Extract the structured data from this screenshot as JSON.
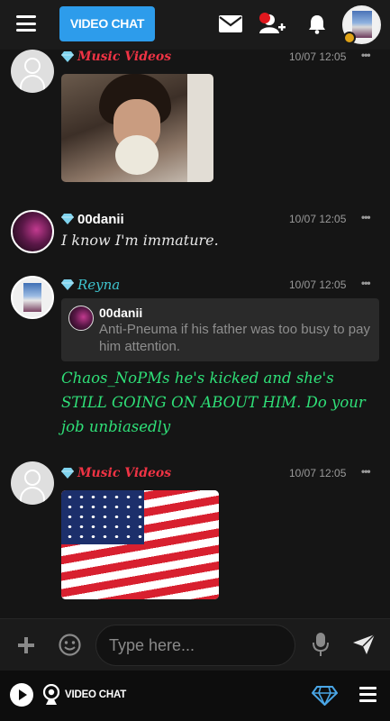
{
  "header": {
    "video_chat_label": "VIDEO CHAT",
    "accent_color": "#2d9ceb"
  },
  "messages": [
    {
      "username": "Music Videos",
      "time": "10/07 12:05",
      "media": "gif"
    },
    {
      "username": "00danii",
      "time": "10/07 12:05",
      "text": "I know I'm immature."
    },
    {
      "username": "Reyna",
      "time": "10/07 12:05",
      "quote": {
        "username": "00danii",
        "text": "Anti-Pneuma if his father was too busy to pay him attention."
      },
      "text": "Chaos_NoPMs he's kicked and she's STILL GOING ON ABOUT HIM. Do your job unbiasedly",
      "text_color": "#2fe078"
    },
    {
      "username": "Music Videos",
      "time": "10/07 12:05",
      "media": "flag-gif"
    }
  ],
  "composer": {
    "placeholder": "Type here..."
  },
  "footer": {
    "video_chat_label": "VIDEO CHAT"
  },
  "icons": {
    "menu": "hamburger-icon",
    "mail": "envelope-icon",
    "friends": "add-friend-icon",
    "notifications": "bell-icon",
    "add": "plus-icon",
    "emoji": "smiley-icon",
    "mic": "microphone-icon",
    "send": "paper-plane-icon",
    "diamond": "diamond-icon"
  }
}
